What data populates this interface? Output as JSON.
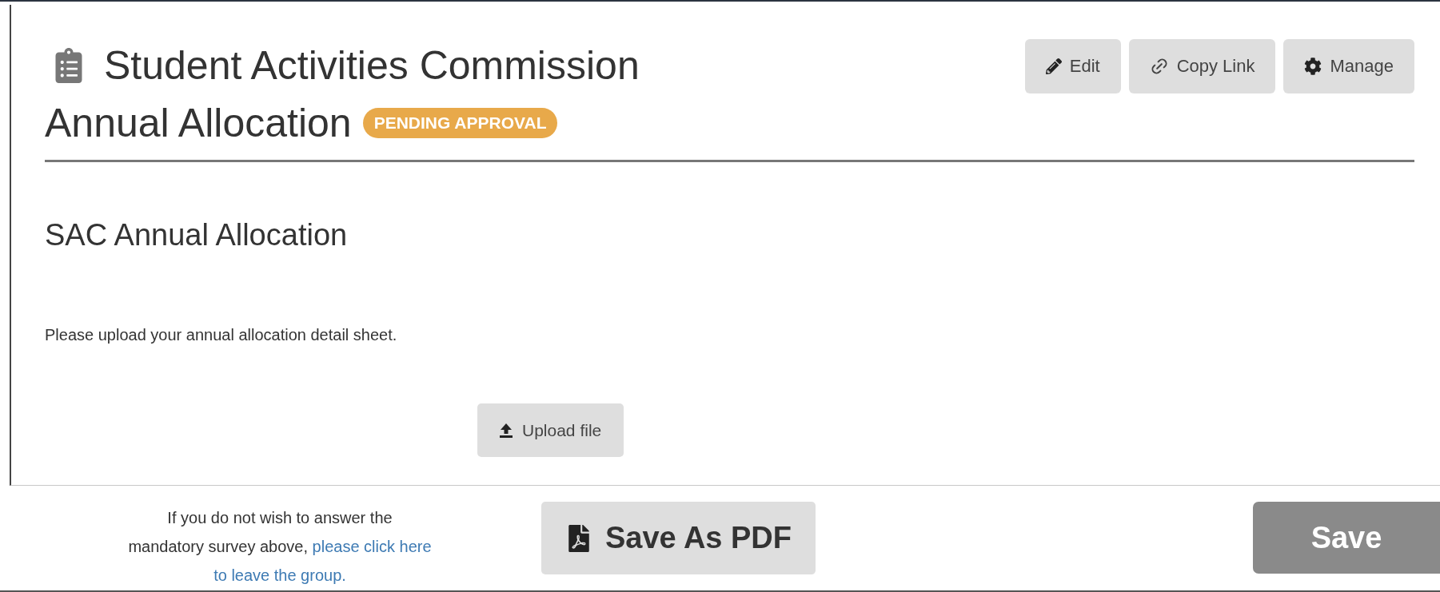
{
  "header": {
    "title_lines": [
      "Student Activities Commission",
      "Annual Allocation"
    ],
    "status": "PENDING APPROVAL"
  },
  "actions": [
    {
      "label": "Edit",
      "kind": "edit"
    },
    {
      "label": "Copy Link",
      "kind": "link"
    },
    {
      "label": "Manage",
      "kind": "manage"
    }
  ],
  "section": {
    "heading": "SAC Annual Allocation",
    "prompt": "Please upload your annual allocation detail sheet.",
    "upload_button": "Upload file"
  },
  "footer": {
    "notice": {
      "text_lines": [
        "If you do not wish to answer the",
        "mandatory survey above,"
      ],
      "link_lines": [
        "please click here",
        "to leave the group."
      ]
    },
    "pdf_button": "Save As PDF",
    "save_button": "Save"
  }
}
